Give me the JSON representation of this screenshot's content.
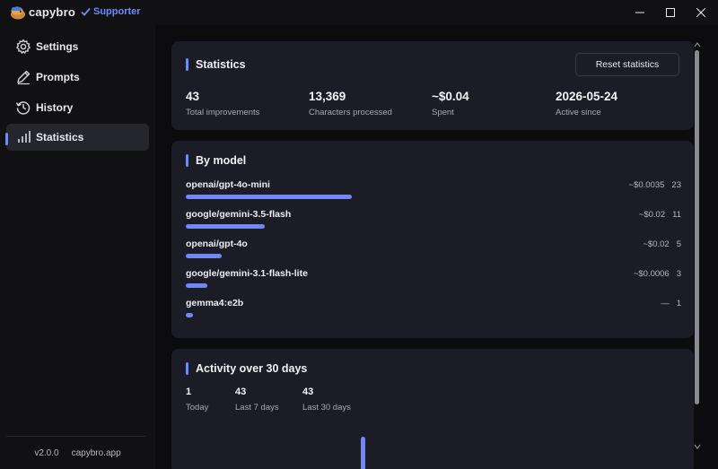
{
  "app": {
    "name": "capybro",
    "badge": "Supporter"
  },
  "sidebar": {
    "items": [
      {
        "label": "Settings",
        "icon": "gear-icon"
      },
      {
        "label": "Prompts",
        "icon": "pen-icon"
      },
      {
        "label": "History",
        "icon": "history-icon"
      },
      {
        "label": "Statistics",
        "icon": "chart-icon",
        "active": true
      }
    ],
    "version": "v2.0.0",
    "site": "capybro.app"
  },
  "statistics": {
    "title": "Statistics",
    "reset_label": "Reset statistics",
    "stats": [
      {
        "value": "43",
        "caption": "Total improvements"
      },
      {
        "value": "13,369",
        "caption": "Characters processed"
      },
      {
        "value": "~$0.04",
        "caption": "Spent"
      },
      {
        "value": "2026-05-24",
        "caption": "Active since"
      }
    ]
  },
  "by_model": {
    "title": "By model",
    "rows": [
      {
        "name": "openai/gpt-4o-mini",
        "cost": "~$0.0035",
        "count": "23",
        "count_value": 23
      },
      {
        "name": "google/gemini-3.5-flash",
        "cost": "~$0.02",
        "count": "11",
        "count_value": 11
      },
      {
        "name": "openai/gpt-4o",
        "cost": "~$0.02",
        "count": "5",
        "count_value": 5
      },
      {
        "name": "google/gemini-3.1-flash-lite",
        "cost": "~$0.0006",
        "count": "3",
        "count_value": 3
      },
      {
        "name": "gemma4:e2b",
        "cost": "—",
        "count": "1",
        "count_value": 1
      }
    ]
  },
  "activity": {
    "title": "Activity over 30 days",
    "stats": [
      {
        "value": "1",
        "caption": "Today"
      },
      {
        "value": "43",
        "caption": "Last 7 days"
      },
      {
        "value": "43",
        "caption": "Last 30 days"
      }
    ]
  },
  "colors": {
    "accent": "#6b8cff",
    "bar": "#7088f5",
    "card": "#1c1c26",
    "background": "#0c0c0f"
  }
}
